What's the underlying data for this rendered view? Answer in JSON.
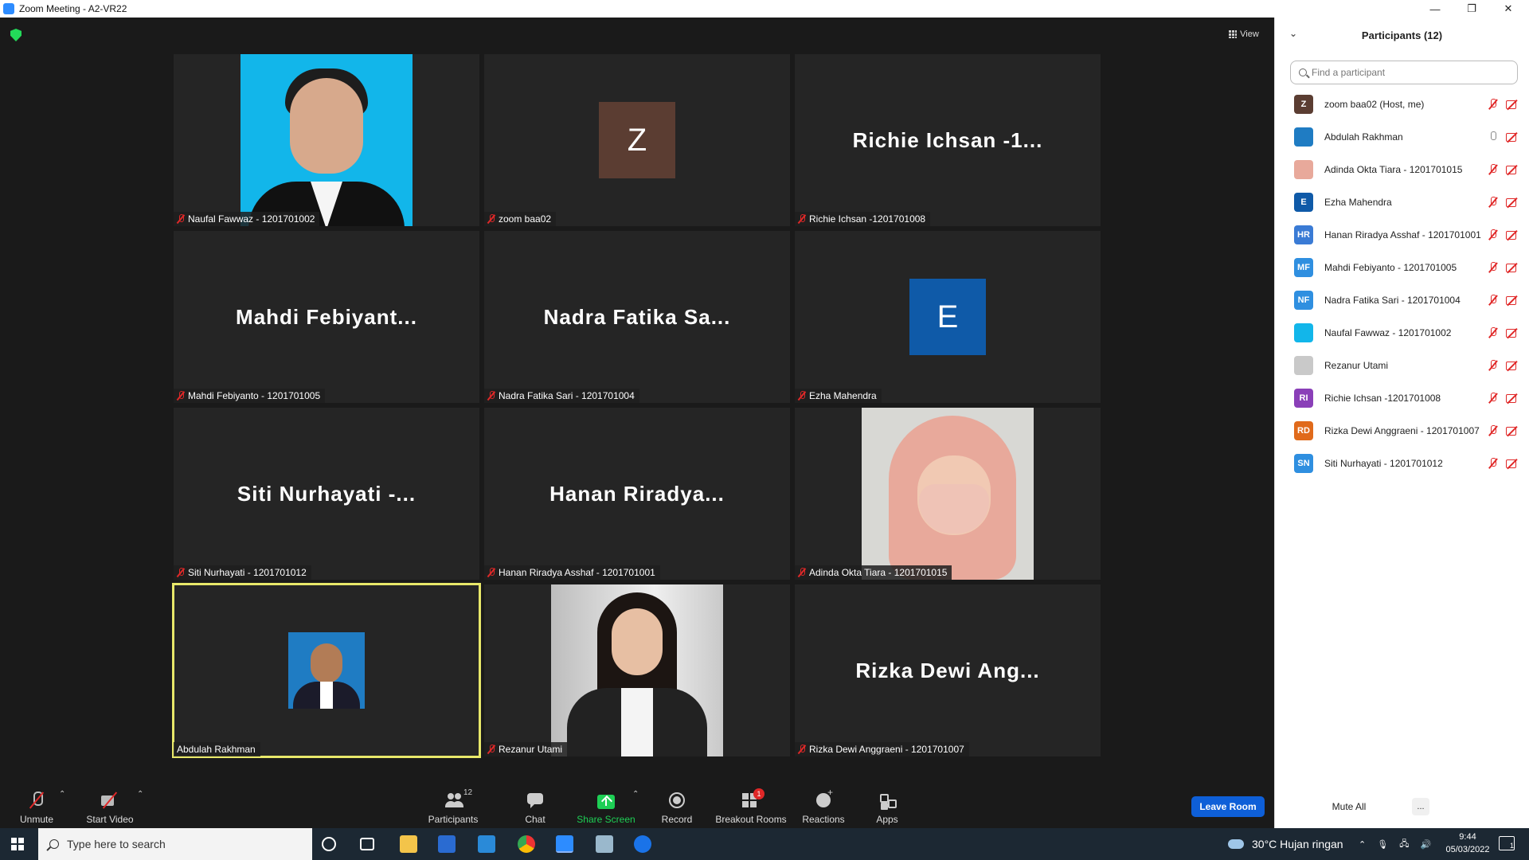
{
  "window": {
    "title": "Zoom Meeting - A2-VR22",
    "minimize": "—",
    "restore": "❐",
    "close": "✕"
  },
  "meeting": {
    "view_label": "View",
    "tiles": [
      {
        "label": "Naufal Fawwaz - 1201701002",
        "kind": "photo",
        "photo": "naufal",
        "muted": true
      },
      {
        "label": "zoom baa02",
        "kind": "avatar",
        "avatar_letter": "Z",
        "avatar_color": "#5b3d32",
        "muted": true
      },
      {
        "label": "Richie Ichsan -1201701008",
        "kind": "name",
        "display_name": "Richie Ichsan -1...",
        "muted": true
      },
      {
        "label": "Mahdi Febiyanto - 1201701005",
        "kind": "name",
        "display_name": "Mahdi Febiyant...",
        "muted": true
      },
      {
        "label": "Nadra Fatika Sari - 1201701004",
        "kind": "name",
        "display_name": "Nadra Fatika Sa...",
        "muted": true
      },
      {
        "label": "Ezha Mahendra",
        "kind": "avatar",
        "avatar_letter": "E",
        "avatar_color": "#0f5aa8",
        "muted": true
      },
      {
        "label": "Siti Nurhayati - 1201701012",
        "kind": "name",
        "display_name": "Siti Nurhayati -...",
        "muted": true
      },
      {
        "label": "Hanan Riradya Asshaf - 1201701001",
        "kind": "name",
        "display_name": "Hanan Riradya...",
        "muted": true
      },
      {
        "label": "Adinda Okta Tiara - 1201701015",
        "kind": "photo",
        "photo": "adinda",
        "muted": true
      },
      {
        "label": "Abdulah Rakhman",
        "kind": "photo-small",
        "photo": "abdulah",
        "muted": false,
        "active_speaker": true
      },
      {
        "label": "Rezanur Utami",
        "kind": "photo",
        "photo": "rezanur",
        "muted": true
      },
      {
        "label": "Rizka Dewi Anggraeni - 1201701007",
        "kind": "name",
        "display_name": "Rizka Dewi Ang...",
        "muted": true
      }
    ]
  },
  "toolbar": {
    "unmute": "Unmute",
    "start_video": "Start Video",
    "participants": "Participants",
    "participants_count": "12",
    "chat": "Chat",
    "share_screen": "Share Screen",
    "record": "Record",
    "breakout_rooms": "Breakout Rooms",
    "breakout_badge": "1",
    "reactions": "Reactions",
    "apps": "Apps",
    "leave": "Leave Room",
    "caret": "⌃",
    "share_color": "#1ecf55",
    "leave_color": "#0e5fd8"
  },
  "panel": {
    "title": "Participants (12)",
    "search_placeholder": "Find a participant",
    "mute_all": "Mute All",
    "more": "...",
    "participants": [
      {
        "name": "zoom baa02 (Host, me)",
        "initials": "Z",
        "color": "#5b3d32",
        "mic": "off"
      },
      {
        "name": "Abdulah Rakhman",
        "initials": "",
        "color": "#1f7cc3",
        "photo": true,
        "mic": "on"
      },
      {
        "name": "Adinda Okta Tiara - 1201701015",
        "initials": "",
        "color": "#e8a99b",
        "photo": true,
        "mic": "off"
      },
      {
        "name": "Ezha Mahendra",
        "initials": "E",
        "color": "#0f5aa8",
        "mic": "off"
      },
      {
        "name": "Hanan Riradya Asshaf - 1201701001",
        "initials": "HR",
        "color": "#3a7bd5",
        "mic": "off"
      },
      {
        "name": "Mahdi Febiyanto - 1201701005",
        "initials": "MF",
        "color": "#2f8fe0",
        "mic": "off"
      },
      {
        "name": "Nadra Fatika Sari - 1201701004",
        "initials": "NF",
        "color": "#2f8fe0",
        "mic": "off"
      },
      {
        "name": "Naufal Fawwaz - 1201701002",
        "initials": "",
        "color": "#12b6ea",
        "photo": true,
        "mic": "off"
      },
      {
        "name": "Rezanur Utami",
        "initials": "",
        "color": "#c9c9c9",
        "photo": true,
        "mic": "off"
      },
      {
        "name": "Richie Ichsan -1201701008",
        "initials": "RI",
        "color": "#8a3fb8",
        "mic": "off"
      },
      {
        "name": "Rizka Dewi Anggraeni - 1201701007",
        "initials": "RD",
        "color": "#e06a1b",
        "mic": "off"
      },
      {
        "name": "Siti Nurhayati - 1201701012",
        "initials": "SN",
        "color": "#2f8fe0",
        "mic": "off"
      }
    ]
  },
  "taskbar": {
    "search_placeholder": "Type here to search",
    "weather": "30°C  Hujan ringan",
    "time": "9:44",
    "date": "05/03/2022",
    "notification_count": "1"
  }
}
